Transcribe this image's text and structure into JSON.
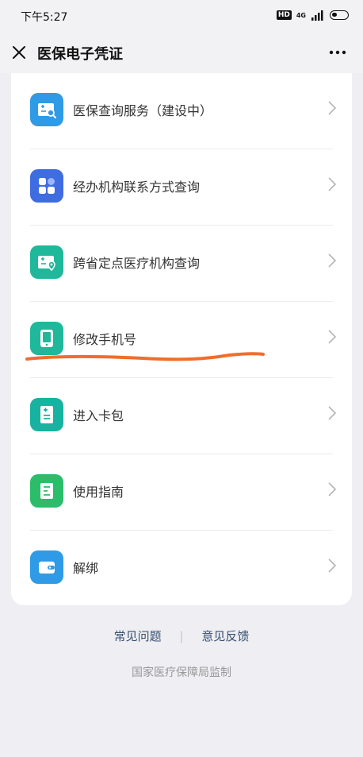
{
  "status": {
    "time": "下午5:27",
    "hd": "HD",
    "net": "4G"
  },
  "header": {
    "title": "医保电子凭证"
  },
  "menu": [
    {
      "label": "医保查询服务（建设中）",
      "icon": "card-search-icon",
      "color": "#2f9be6"
    },
    {
      "label": "经办机构联系方式查询",
      "icon": "apps-grid-icon",
      "color": "#3f6ce0"
    },
    {
      "label": "跨省定点医疗机构查询",
      "icon": "card-location-icon",
      "color": "#1fb89a"
    },
    {
      "label": "修改手机号",
      "icon": "phone-icon",
      "color": "#1fb89a"
    },
    {
      "label": "进入卡包",
      "icon": "card-holder-icon",
      "color": "#17b3a0"
    },
    {
      "label": "使用指南",
      "icon": "guide-icon",
      "color": "#2bbd6a"
    },
    {
      "label": "解绑",
      "icon": "wallet-icon",
      "color": "#2f9be6"
    }
  ],
  "footer": {
    "faq": "常见问题",
    "separator": "|",
    "feedback": "意见反馈",
    "supervisor": "国家医疗保障局监制"
  },
  "colors": {
    "underline": "#f06d2c",
    "accent_link": "#36506f"
  }
}
